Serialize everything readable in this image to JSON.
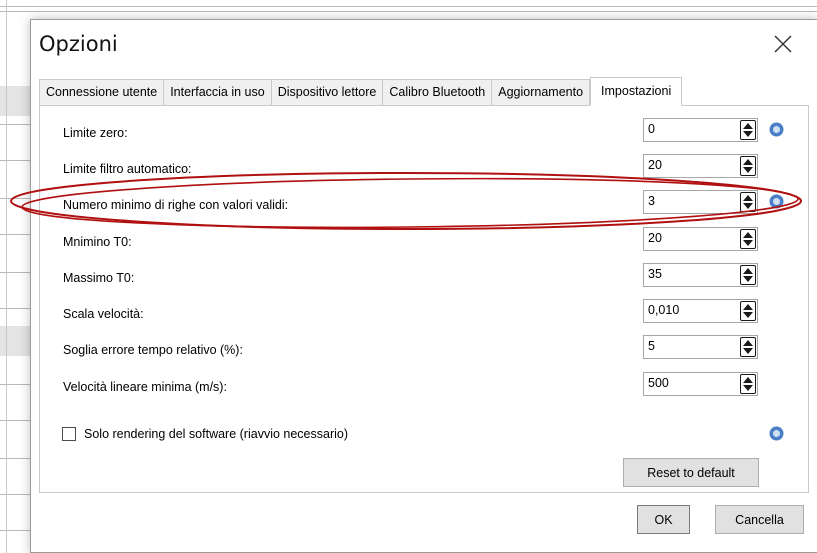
{
  "dialog": {
    "title": "Opzioni",
    "close_icon": "close-icon"
  },
  "tabs": [
    {
      "label": "Connessione utente",
      "active": false
    },
    {
      "label": "Interfaccia in uso",
      "active": false
    },
    {
      "label": "Dispositivo lettore",
      "active": false
    },
    {
      "label": "Calibro Bluetooth",
      "active": false
    },
    {
      "label": "Aggiornamento",
      "active": false
    },
    {
      "label": "Impostazioni",
      "active": true
    }
  ],
  "settings": [
    {
      "label": "Limite zero:",
      "value": "0",
      "help": true
    },
    {
      "label": "Limite filtro automatico:",
      "value": "20",
      "help": false
    },
    {
      "label": "Numero minimo di righe con valori validi:",
      "value": "3",
      "help": true,
      "highlighted": true
    },
    {
      "label": "Mnimino T0:",
      "value": "20",
      "help": false
    },
    {
      "label": "Massimo T0:",
      "value": "35",
      "help": false
    },
    {
      "label": "Scala velocità:",
      "value": "0,010",
      "help": false
    },
    {
      "label": "Soglia errore tempo relativo (%):",
      "value": "5",
      "help": false
    },
    {
      "label": "Velocità lineare minima (m/s):",
      "value": "500",
      "help": false
    }
  ],
  "software_rendering": {
    "label": "Solo rendering del software (riavvio necessario)",
    "checked": false
  },
  "buttons": {
    "reset": "Reset to default",
    "ok": "OK",
    "cancel": "Cancella"
  },
  "colors": {
    "annotation": "#b01010",
    "help_icon": "#4a7fc8"
  }
}
